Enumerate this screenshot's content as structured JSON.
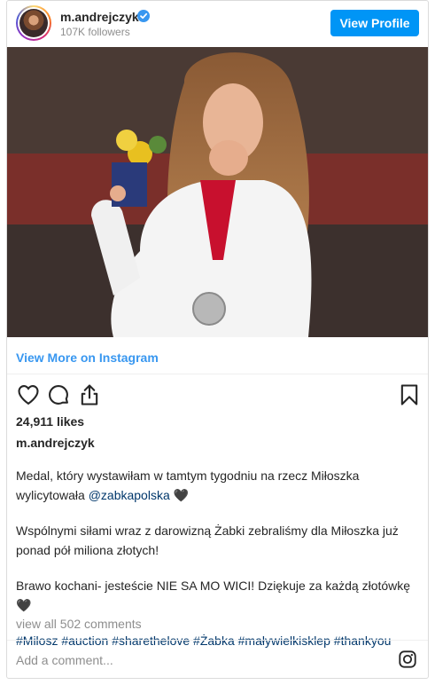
{
  "header": {
    "username": "m.andrejczyk",
    "followers": "107K followers",
    "view_profile_label": "View Profile"
  },
  "post": {
    "view_more_label": "View More on Instagram",
    "likes": "24,911 likes",
    "caption_username": "m.andrejczyk",
    "caption": {
      "p1_text": "Medal, który wystawiłam w tamtym tygodniu na rzecz Miłoszka wylicytowała ",
      "p1_mention": "@zabkapolska",
      "p1_tail": " 🖤",
      "p2": "Wspólnymi siłami wraz z darowizną Żabki zebraliśmy dla Miłoszka już ponad pół miliona złotych!",
      "p3": "Brawo kochani- jesteście NIE SA MO WICI! Dziękuje za każdą złotówkę 🖤",
      "hashtags": [
        "#Milosz",
        "#auction",
        "#sharethelove",
        "#Żabka",
        "#maływielkisklep",
        "#thankyou"
      ]
    },
    "view_comments": "view all 502 comments",
    "comment_placeholder": "Add a comment..."
  },
  "icons": [
    "verified-badge-icon",
    "heart-icon",
    "comment-icon",
    "share-icon",
    "bookmark-icon",
    "instagram-icon"
  ],
  "colors": {
    "accent": "#0095f6",
    "link": "#3897f0",
    "hashtag": "#00376b",
    "muted": "#8e8e8e"
  }
}
